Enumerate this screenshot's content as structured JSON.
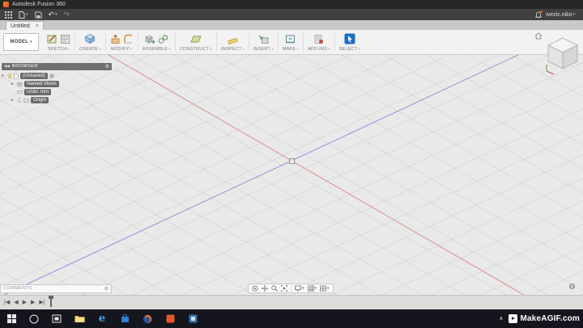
{
  "glyphs": {
    "caret": "▾",
    "close": "×",
    "undo": "↶",
    "redo": "↷",
    "collapse_left": "◀◀",
    "gear": "⚙",
    "expanded": "▾",
    "collapsed": "▸",
    "tray_up": "∧"
  },
  "title_bar": {
    "app_title": "Autodesk Fusion 360"
  },
  "app_bar": {
    "user_name": "ivezic.niko"
  },
  "tab_bar": {
    "tabs": [
      {
        "label": "Untitled"
      }
    ]
  },
  "ribbon": {
    "workspace_label": "MODEL",
    "groups": [
      {
        "label": "SKETCH"
      },
      {
        "label": "CREATE"
      },
      {
        "label": "MODIFY"
      },
      {
        "label": "ASSEMBLE"
      },
      {
        "label": "CONSTRUCT"
      },
      {
        "label": "INSPECT"
      },
      {
        "label": "INSERT"
      },
      {
        "label": "MAKE"
      },
      {
        "label": "ADD-INS"
      },
      {
        "label": "SELECT"
      }
    ]
  },
  "browser": {
    "title": "BROWSER",
    "items": [
      {
        "label": "(Unsaved)"
      },
      {
        "label": "Named Views"
      },
      {
        "label": "Units: mm"
      },
      {
        "label": "Origin"
      }
    ]
  },
  "comments_panel": {
    "title": "COMMENTS"
  },
  "timeline": {
    "controls": [
      "|◀",
      "◀",
      "▶",
      "▶",
      "▶|"
    ]
  },
  "watermark": {
    "text": "MakeAGIF.com"
  },
  "colors": {
    "axis_x": "#d98f8f",
    "axis_z": "#9393d6",
    "select_highlight": "#1e6fc0",
    "taskbar_bg": "#15151d",
    "fusion_orange": "#f2641e"
  }
}
